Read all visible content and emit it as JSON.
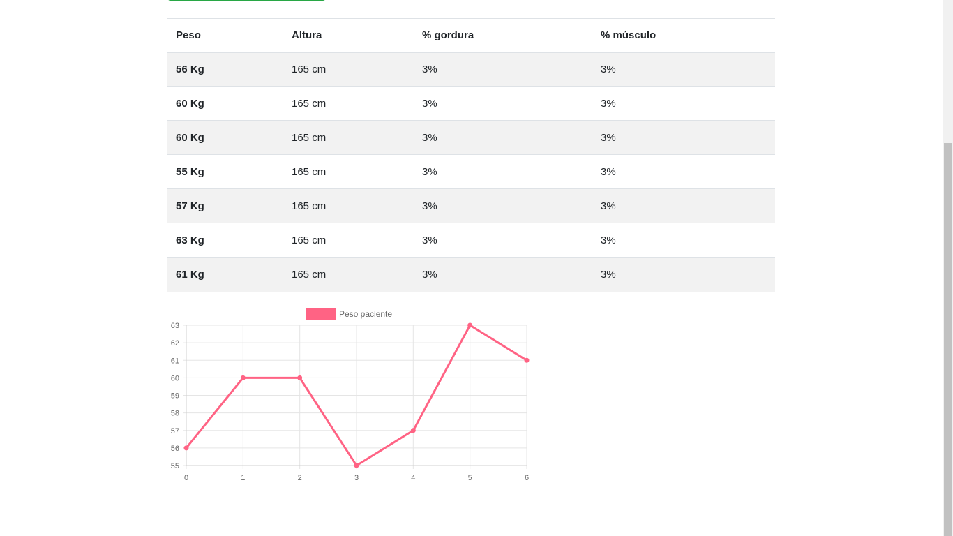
{
  "table": {
    "headers": [
      "Peso",
      "Altura",
      "% gordura",
      "% músculo"
    ],
    "rows": [
      [
        "56 Kg",
        "165 cm",
        "3%",
        "3%"
      ],
      [
        "60 Kg",
        "165 cm",
        "3%",
        "3%"
      ],
      [
        "60 Kg",
        "165 cm",
        "3%",
        "3%"
      ],
      [
        "55 Kg",
        "165 cm",
        "3%",
        "3%"
      ],
      [
        "57 Kg",
        "165 cm",
        "3%",
        "3%"
      ],
      [
        "63 Kg",
        "165 cm",
        "3%",
        "3%"
      ],
      [
        "61 Kg",
        "165 cm",
        "3%",
        "3%"
      ]
    ]
  },
  "colors": {
    "series": "#ff6384",
    "grid": "#e5e5e5",
    "tick": "#666666"
  },
  "chart_data": {
    "type": "line",
    "x": [
      0,
      1,
      2,
      3,
      4,
      5,
      6
    ],
    "series": [
      {
        "name": "Peso paciente",
        "values": [
          56,
          60,
          60,
          55,
          57,
          63,
          61
        ]
      }
    ],
    "xlim": [
      0,
      6
    ],
    "ylim": [
      55,
      63
    ],
    "yticks": [
      55,
      56,
      57,
      58,
      59,
      60,
      61,
      62,
      63
    ],
    "grid": true,
    "legend": "top-center"
  }
}
